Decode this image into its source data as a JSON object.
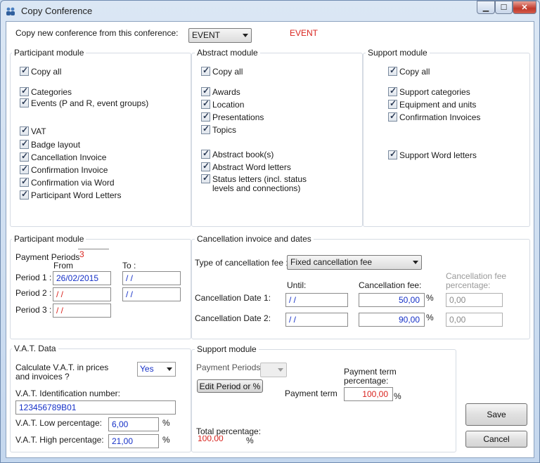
{
  "window": {
    "title": "Copy Conference"
  },
  "top": {
    "copy_from_label": "Copy new conference from this conference:",
    "event_select": "EVENT",
    "event_tag": "EVENT"
  },
  "participant_module": {
    "title": "Participant module",
    "items": [
      "Copy all",
      "Categories",
      "Events (P and R, event groups)",
      "VAT",
      "Badge layout",
      "Cancellation Invoice",
      "Confirmation Invoice",
      "Confirmation via Word",
      "Participant Word Letters"
    ]
  },
  "abstract_module": {
    "title": "Abstract module",
    "items": [
      "Copy all",
      "Awards",
      "Location",
      "Presentations",
      "Topics",
      "Abstract book(s)",
      "Abstract Word letters",
      "Status letters (incl. status",
      "levels and connections)"
    ]
  },
  "support_module": {
    "title": "Support module",
    "items": [
      "Copy all",
      "Support categories",
      "Equipment and units",
      "Confirmation Invoices",
      "Support Word letters"
    ]
  },
  "participant_periods": {
    "title": "Participant module",
    "payment_periods_label": "Payment Periods",
    "payment_periods_value": "3",
    "from_label": "From",
    "to_label": "To :",
    "period1_label": "Period 1 :",
    "period2_label": "Period 2 :",
    "period3_label": "Period 3 :",
    "period1_from": "26/02/2015",
    "period1_to": "/ /",
    "period2_from": "/ /",
    "period2_to": "/ /",
    "period3_from": "/ /"
  },
  "cancellation": {
    "title": "Cancellation invoice and dates",
    "type_label": "Type of cancellation fee :",
    "type_value": "Fixed cancellation fee",
    "until_label": "Until:",
    "fee_label": "Cancellation fee:",
    "fee_pct_label_1": "Cancellation fee",
    "fee_pct_label_2": "percentage:",
    "date1_label": "Cancellation Date 1:",
    "date2_label": "Cancellation Date 2:",
    "date1_until": "/ /",
    "date2_until": "/ /",
    "date1_fee": "50,00",
    "date2_fee": "90,00",
    "date1_pct": "0,00",
    "date2_pct": "0,00",
    "pct_sign": "%"
  },
  "vat": {
    "title": "V.A.T. Data",
    "calc_label_1": "Calculate V.A.T. in prices",
    "calc_label_2": "and invoices ?",
    "calc_value": "Yes",
    "id_label": "V.A.T. Identification number:",
    "id_value": "123456789B01",
    "low_label": "V.A.T. Low percentage:",
    "low_value": "6,00",
    "high_label": "V.A.T. High percentage:",
    "high_value": "21,00",
    "pct_sign": "%"
  },
  "support_periods": {
    "title": "Support module",
    "payment_periods_label": "Payment Periods",
    "edit_button": "Edit Period or %",
    "payment_term_label": "Payment term",
    "term_pct_label_1": "Payment term",
    "term_pct_label_2": "percentage:",
    "term_pct_value": "100,00",
    "total_label": "Total percentage:",
    "total_value": "100,00",
    "pct_sign": "%"
  },
  "actions": {
    "save": "Save",
    "cancel": "Cancel"
  }
}
